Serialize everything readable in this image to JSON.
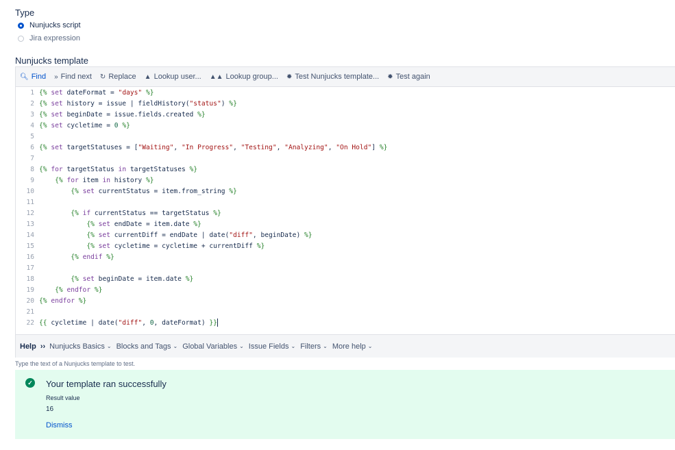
{
  "type_section": {
    "label": "Type",
    "options": [
      {
        "label": "Nunjucks script",
        "checked": true
      },
      {
        "label": "Jira expression",
        "checked": false
      }
    ]
  },
  "template_section": {
    "label": "Nunjucks template"
  },
  "toolbar": {
    "find": "Find",
    "find_next": "Find next",
    "replace": "Replace",
    "lookup_user": "Lookup user...",
    "lookup_group": "Lookup group...",
    "test_template": "Test Nunjucks template...",
    "test_again": "Test again"
  },
  "code_lines": [
    "{% set dateFormat = \"days\" %}",
    "{% set history = issue | fieldHistory(\"status\") %}",
    "{% set beginDate = issue.fields.created %}",
    "{% set cycletime = 0 %}",
    "",
    "{% set targetStatuses = [\"Waiting\", \"In Progress\", \"Testing\", \"Analyzing\", \"On Hold\"] %}",
    "",
    "{% for targetStatus in targetStatuses %}",
    "    {% for item in history %}",
    "        {% set currentStatus = item.from_string %}",
    "",
    "        {% if currentStatus == targetStatus %}",
    "            {% set endDate = item.date %}",
    "            {% set currentDiff = endDate | date(\"diff\", beginDate) %}",
    "            {% set cycletime = cycletime + currentDiff %}",
    "        {% endif %}",
    "",
    "        {% set beginDate = item.date %}",
    "    {% endfor %}",
    "{% endfor %}",
    "",
    "{{ cycletime | date(\"diff\", 0, dateFormat) }}"
  ],
  "help_bar": {
    "help": "Help",
    "arrows": "››",
    "items": [
      "Nunjucks Basics",
      "Blocks and Tags",
      "Global Variables",
      "Issue Fields",
      "Filters",
      "More help"
    ]
  },
  "hint": "Type the text of a Nunjucks template to test.",
  "result": {
    "title": "Your template ran successfully",
    "value_label": "Result value",
    "value": "16",
    "dismiss": "Dismiss"
  },
  "colors": {
    "accent": "#0052cc",
    "success_bg": "#e3fcef",
    "success_icon": "#00875a"
  }
}
